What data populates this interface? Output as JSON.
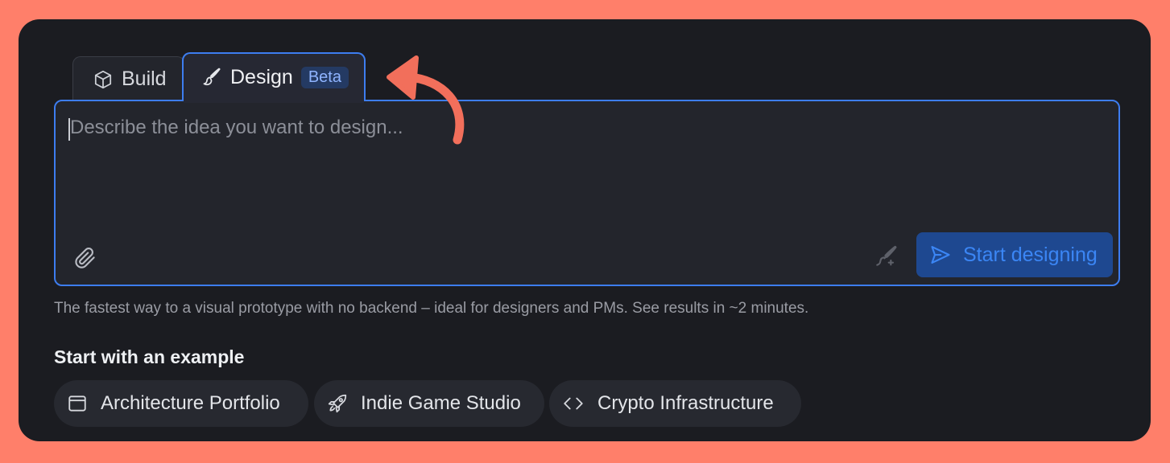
{
  "tabs": {
    "build": {
      "label": "Build",
      "icon": "cube-icon"
    },
    "design": {
      "label": "Design",
      "badge": "Beta",
      "icon": "brush-icon"
    }
  },
  "prompt": {
    "placeholder": "Describe the idea you want to design...",
    "value": ""
  },
  "actions": {
    "attach_icon": "paperclip-icon",
    "enhance_icon": "magic-wand-icon",
    "start_label": "Start designing",
    "start_icon": "send-icon"
  },
  "hint": "The fastest way to a visual prototype with no backend – ideal for designers and PMs. See results in ~2 minutes.",
  "examples": {
    "title": "Start with an example",
    "items": [
      {
        "label": "Architecture Portfolio",
        "icon": "browser-window-icon"
      },
      {
        "label": "Indie Game Studio",
        "icon": "rocket-icon"
      },
      {
        "label": "Crypto Infrastructure",
        "icon": "code-brackets-icon"
      }
    ]
  },
  "colors": {
    "background": "#ff7f6a",
    "panel": "#1b1c21",
    "accent": "#3d7df0",
    "annotation_arrow": "#f26f5b"
  }
}
